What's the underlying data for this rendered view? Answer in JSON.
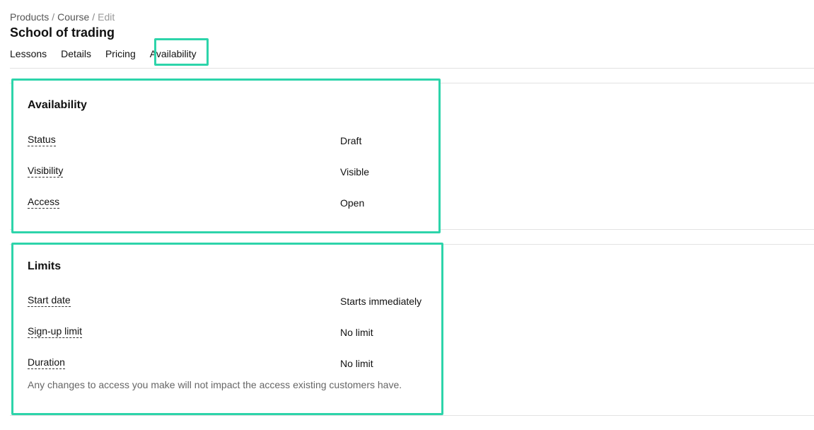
{
  "breadcrumb": {
    "items": [
      "Products",
      "Course"
    ],
    "separator": "/",
    "current": "Edit"
  },
  "page": {
    "title": "School of trading"
  },
  "tabs": [
    {
      "label": "Lessons",
      "active": false
    },
    {
      "label": "Details",
      "active": false
    },
    {
      "label": "Pricing",
      "active": false
    },
    {
      "label": "Availability",
      "active": true
    }
  ],
  "availability": {
    "title": "Availability",
    "rows": [
      {
        "label": "Status",
        "value": "Draft"
      },
      {
        "label": "Visibility",
        "value": "Visible"
      },
      {
        "label": "Access",
        "value": "Open"
      }
    ]
  },
  "limits": {
    "title": "Limits",
    "rows": [
      {
        "label": "Start date",
        "value": "Starts immediately"
      },
      {
        "label": "Sign-up limit",
        "value": "No limit"
      },
      {
        "label": "Duration",
        "value": "No limit"
      }
    ],
    "note": "Any changes to access you make will not impact the access existing customers have."
  },
  "colors": {
    "highlight": "#2dd4aa",
    "divider": "#e2e2e2",
    "muted_text": "#666666"
  }
}
